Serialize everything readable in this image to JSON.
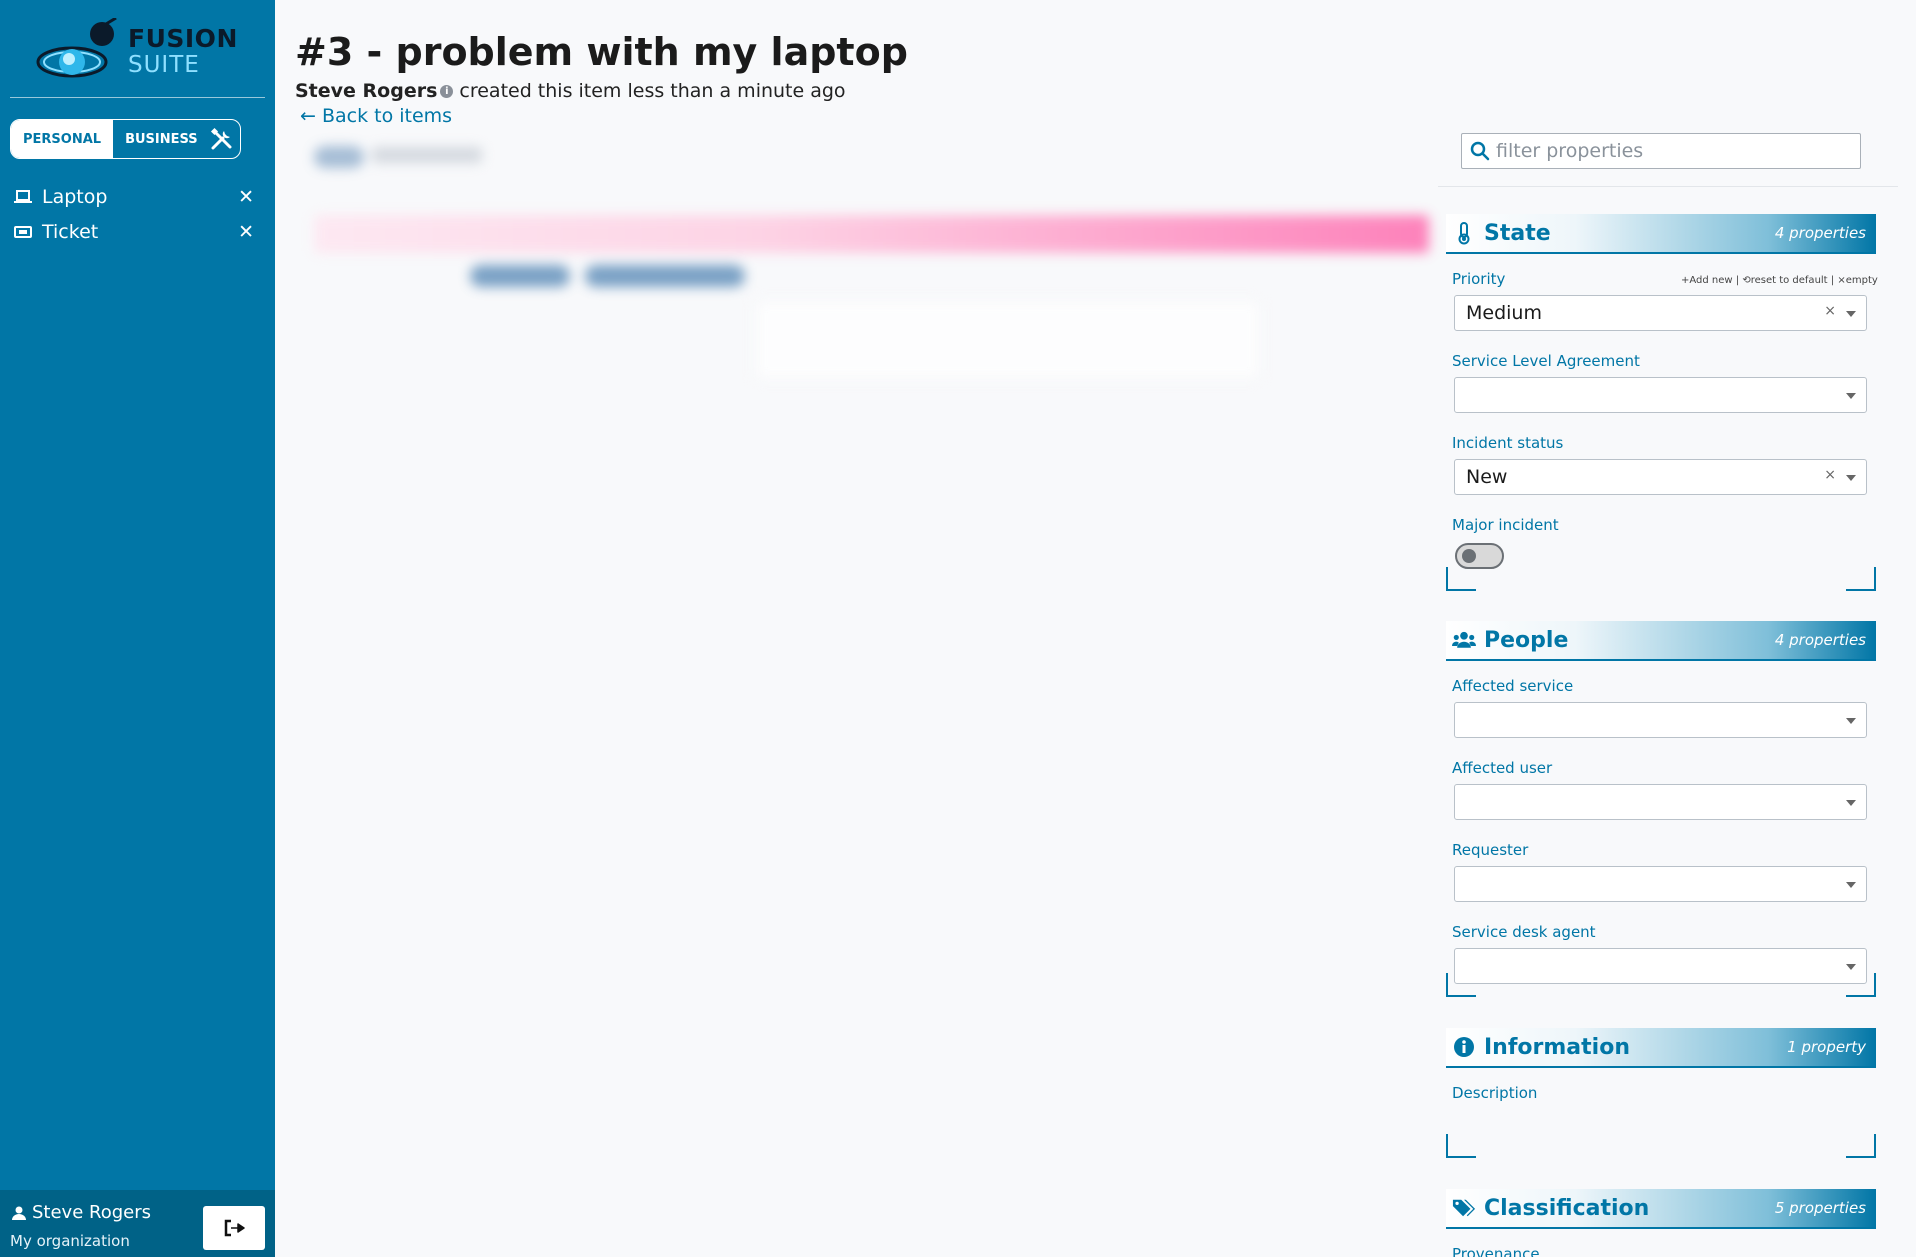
{
  "brand": {
    "line1": "FUSION",
    "line2": "SUITE"
  },
  "mode": {
    "personal": "PERSONAL",
    "business": "BUSINESS"
  },
  "nav": [
    {
      "label": "Laptop",
      "icon": "laptop-icon"
    },
    {
      "label": "Ticket",
      "icon": "ticket-icon"
    }
  ],
  "user": {
    "name": "Steve Rogers",
    "org": "My organization"
  },
  "header": {
    "title": "#3 - problem with my laptop",
    "author": "Steve Rogers",
    "created_text": "created this item less than a minute ago",
    "back_link": "← Back to items"
  },
  "filter": {
    "placeholder": "filter properties"
  },
  "sections": {
    "state": {
      "title": "State",
      "count": "4 properties",
      "actions": "+Add new | ⟲reset to default | ×empty",
      "priority": {
        "label": "Priority",
        "value": "Medium"
      },
      "sla": {
        "label": "Service Level Agreement",
        "value": ""
      },
      "incident_status": {
        "label": "Incident status",
        "value": "New"
      },
      "major_incident": {
        "label": "Major incident",
        "checked": false
      }
    },
    "people": {
      "title": "People",
      "count": "4 properties",
      "affected_service": {
        "label": "Affected service"
      },
      "affected_user": {
        "label": "Affected user"
      },
      "requester": {
        "label": "Requester"
      },
      "service_desk_agent": {
        "label": "Service desk agent"
      }
    },
    "information": {
      "title": "Information",
      "count": "1 property",
      "description": {
        "label": "Description"
      }
    },
    "classification": {
      "title": "Classification",
      "count": "5 properties",
      "provenance": {
        "label": "Provenance"
      }
    }
  },
  "colors": {
    "brand": "#0176a6",
    "sidebar": "#0176a6",
    "timeline_accent": "#ff5aa5"
  }
}
